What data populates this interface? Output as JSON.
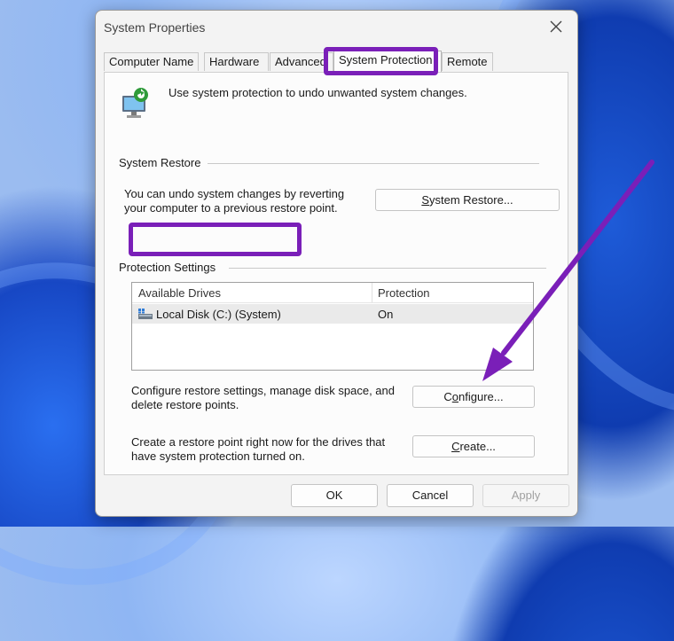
{
  "window": {
    "title": "System Properties"
  },
  "tabs": [
    {
      "label": "Computer Name"
    },
    {
      "label": "Hardware"
    },
    {
      "label": "Advanced"
    },
    {
      "label": "System Protection",
      "active": true
    },
    {
      "label": "Remote"
    }
  ],
  "intro": {
    "text": "Use system protection to undo unwanted system changes."
  },
  "system_restore": {
    "group_label": "System Restore",
    "description_line1": "You can undo system changes by reverting",
    "description_line2": "your computer to a previous restore point.",
    "button_label_underlined": "S",
    "button_label_rest": "ystem Restore..."
  },
  "protection_settings": {
    "group_label": "Protection Settings",
    "columns": [
      "Available Drives",
      "Protection"
    ],
    "rows": [
      {
        "drive": "Local Disk (C:) (System)",
        "protection": "On"
      }
    ],
    "configure_description_line1": "Configure restore settings, manage disk space, and",
    "configure_description_line2": "delete restore points.",
    "configure_button_pre": "C",
    "configure_button_underlined": "o",
    "configure_button_rest": "nfigure...",
    "create_description_line1": "Create a restore point right now for the drives that",
    "create_description_line2": "have system protection turned on.",
    "create_button_pre": "",
    "create_button_underlined": "C",
    "create_button_rest": "reate..."
  },
  "footer": {
    "ok_label": "OK",
    "cancel_label": "Cancel",
    "apply_label": "Apply"
  },
  "colors": {
    "highlight": "#7a1fb8",
    "wallpaper_accent": "#1e5bd8"
  }
}
